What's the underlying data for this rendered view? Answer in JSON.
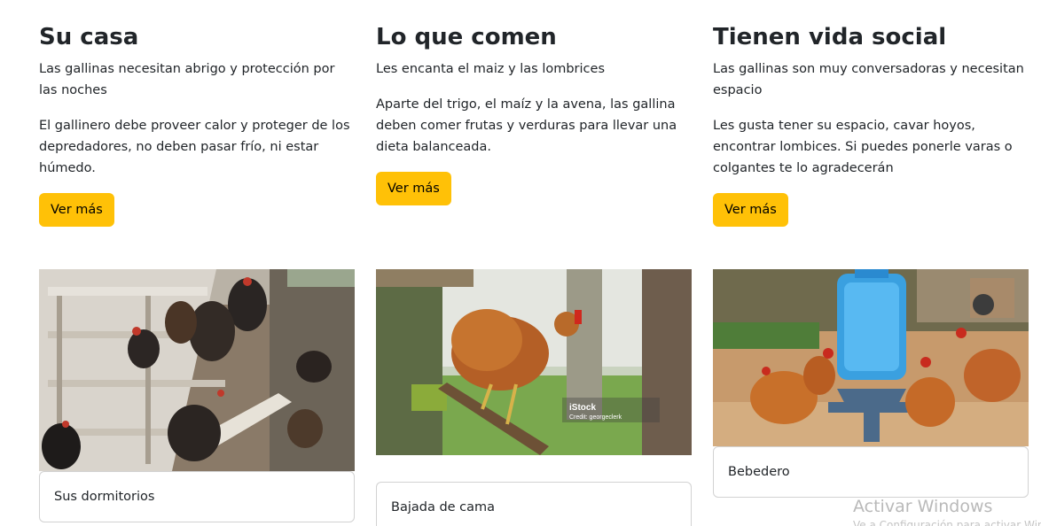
{
  "columns": [
    {
      "title": "Su casa",
      "lead": "Las gallinas necesitan abrigo y protección por las noches",
      "body": "El gallinero debe proveer calor y proteger de los depredadores, no deben pasar frío, ni estar húmedo.",
      "button_label": "Ver más",
      "image_caption": "Sus dormitorios"
    },
    {
      "title": "Lo que comen",
      "lead": "Les encanta el maiz y las lombrices",
      "body": "Aparte del trigo, el maíz y la avena, las gallina deben comer frutas y verduras para llevar una dieta balanceada.",
      "button_label": "Ver más",
      "image_caption": "Bajada de cama",
      "image_watermark": "iStock",
      "image_credit": "Credit: georgeclerk"
    },
    {
      "title": "Tienen vida social",
      "lead": "Las gallinas son muy conversadoras y necesitan espacio",
      "body": "Les gusta tener su espacio, cavar hoyos, encontrar lombices. Si puedes ponerle varas o colgantes te lo agradecerán",
      "button_label": "Ver más",
      "image_caption": "Bebedero"
    }
  ],
  "os_watermark": {
    "title": "Activar Windows",
    "subtitle": "Ve a Configuración para activar Windows."
  },
  "colors": {
    "button": "#ffc107",
    "text": "#212529"
  }
}
